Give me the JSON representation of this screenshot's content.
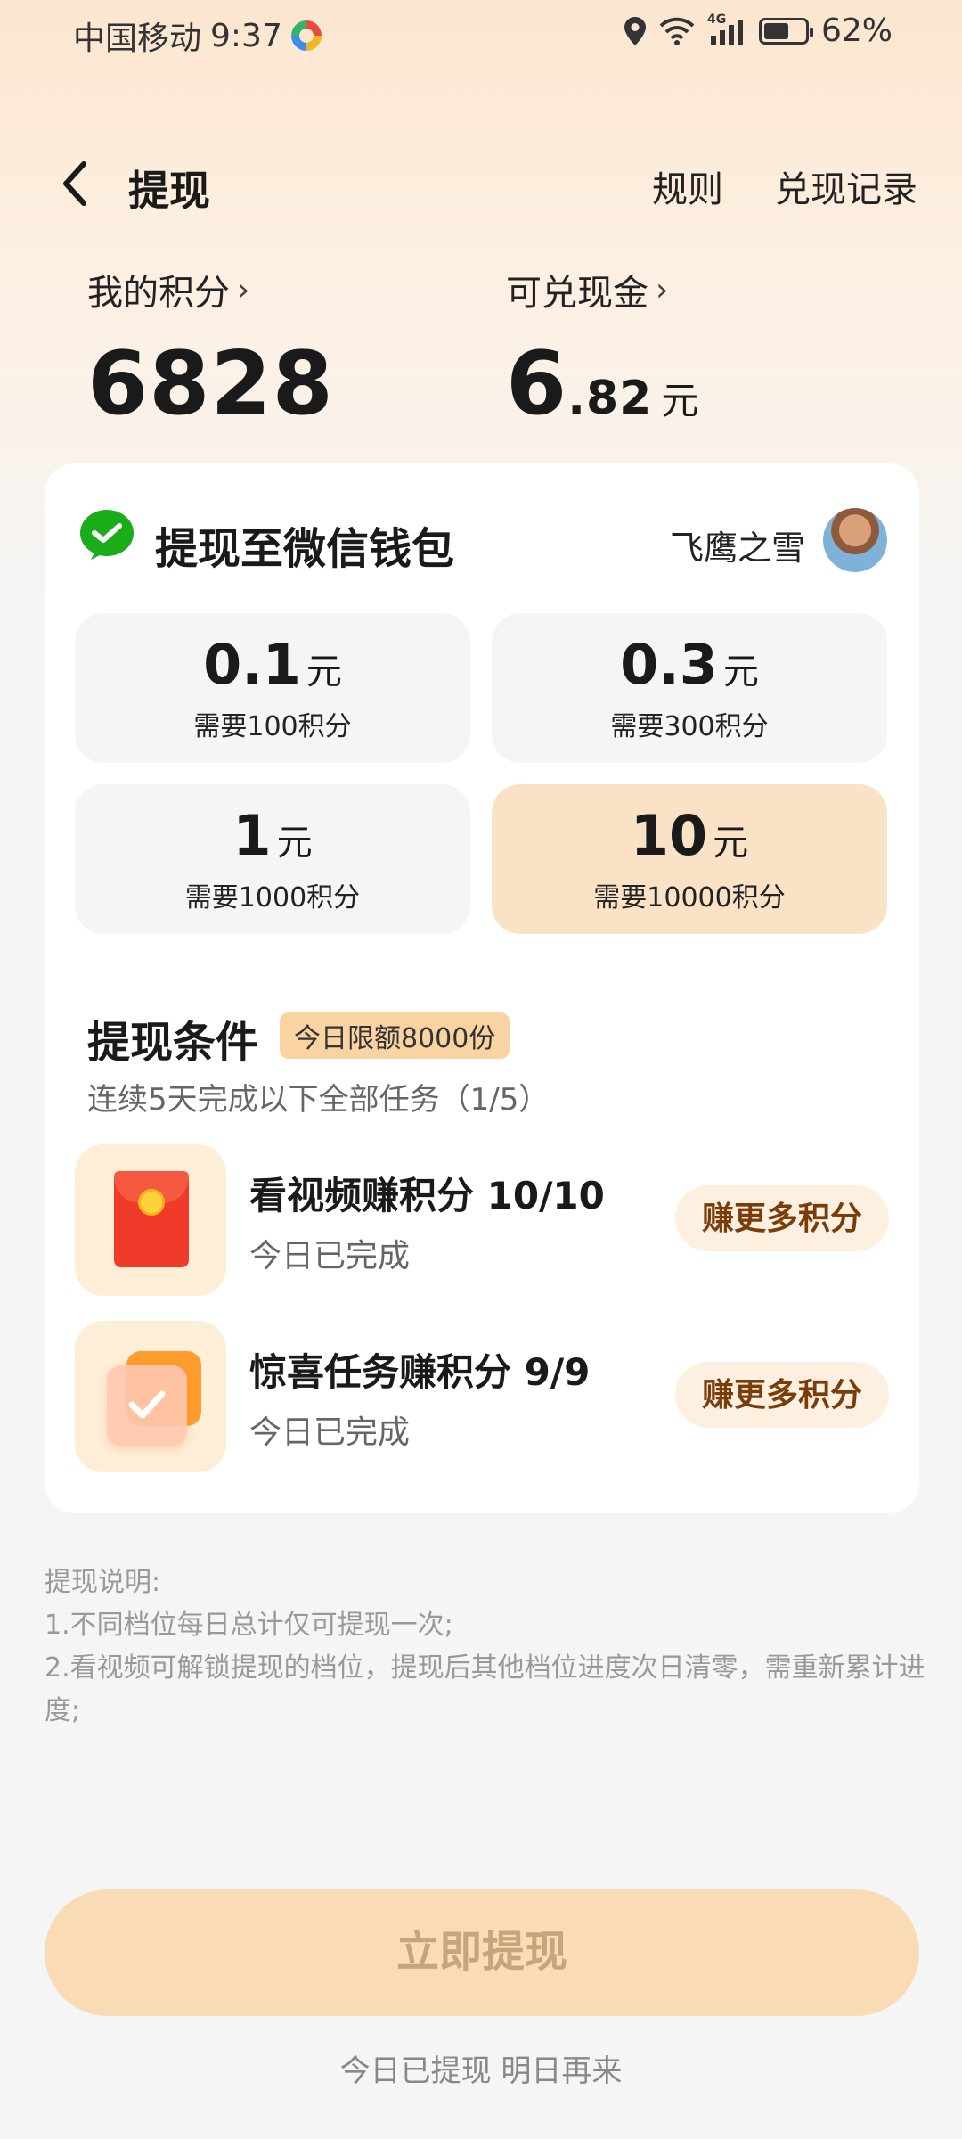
{
  "status_bar": {
    "carrier": "中国移动",
    "time": "9:37",
    "network": "4G",
    "battery_level": 0.62,
    "battery_percent": "62%"
  },
  "header": {
    "title": "提现",
    "rules_label": "规则",
    "records_label": "兑现记录"
  },
  "stats": {
    "points_label": "我的积分",
    "points_value": "6828",
    "cash_label": "可兑现金",
    "cash_int": "6",
    "cash_dec": ".82",
    "cash_unit": "元",
    "chevron": "›"
  },
  "wallet": {
    "title": "提现至微信钱包",
    "username": "飞鹰之雪"
  },
  "tiers": [
    {
      "amount": "0.1",
      "unit": "元",
      "requirement": "需要100积分",
      "selected": false
    },
    {
      "amount": "0.3",
      "unit": "元",
      "requirement": "需要300积分",
      "selected": false
    },
    {
      "amount": "1",
      "unit": "元",
      "requirement": "需要1000积分",
      "selected": false
    },
    {
      "amount": "10",
      "unit": "元",
      "requirement": "需要10000积分",
      "selected": true
    }
  ],
  "conditions": {
    "title": "提现条件",
    "badge": "今日限额8000份",
    "subtitle": "连续5天完成以下全部任务（1/5）",
    "tasks": [
      {
        "name": "看视频赚积分 10/10",
        "status": "今日已完成",
        "button": "赚更多积分",
        "icon": "red-envelope-icon"
      },
      {
        "name": "惊喜任务赚积分 9/9",
        "status": "今日已完成",
        "button": "赚更多积分",
        "icon": "checkmark-task-icon"
      }
    ]
  },
  "notes": {
    "title": "提现说明:",
    "line1": "1.不同档位每日总计仅可提现一次;",
    "line2": "2.看视频可解锁提现的档位，提现后其他档位进度次日清零，需重新累计进度;"
  },
  "footer": {
    "button_label": "立即提现",
    "note": "今日已提现 明日再来"
  },
  "colors": {
    "accent_light": "#fae2c6",
    "button_disabled_bg": "#f9dcb5",
    "wechat_green": "#1aad19",
    "task_button_text": "#7a3d0a"
  }
}
